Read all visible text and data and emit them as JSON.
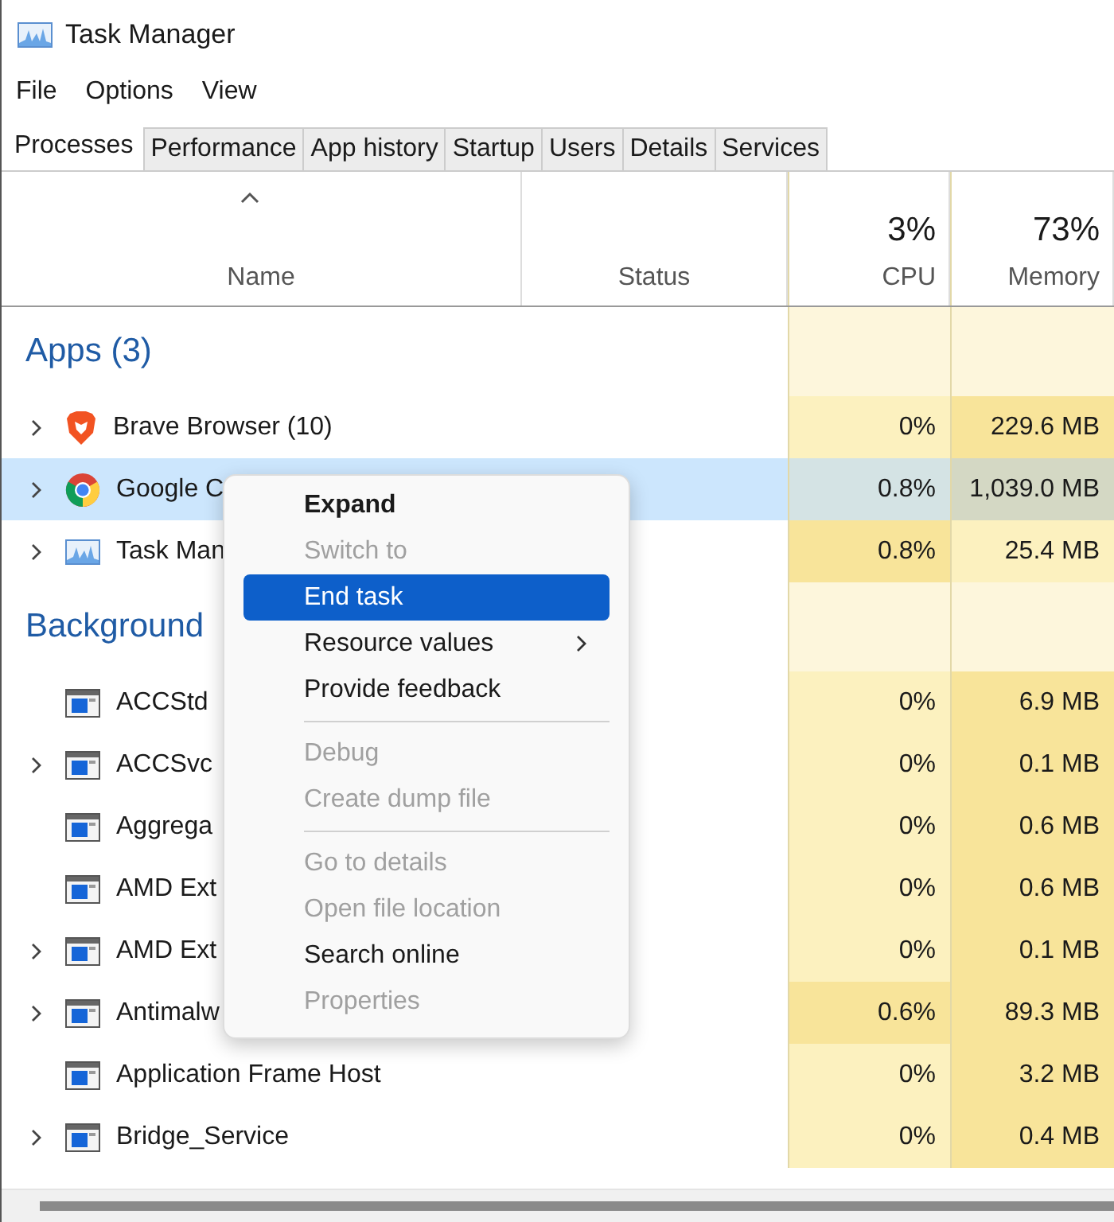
{
  "window": {
    "title": "Task Manager"
  },
  "menu": [
    "File",
    "Options",
    "View"
  ],
  "tabs": [
    {
      "label": "Processes",
      "selected": true
    },
    {
      "label": "Performance",
      "selected": false
    },
    {
      "label": "App history",
      "selected": false
    },
    {
      "label": "Startup",
      "selected": false
    },
    {
      "label": "Users",
      "selected": false
    },
    {
      "label": "Details",
      "selected": false
    },
    {
      "label": "Services",
      "selected": false
    }
  ],
  "table": {
    "columns": [
      {
        "label": "Name"
      },
      {
        "label": "Status"
      },
      {
        "label": "CPU",
        "summary": "3%"
      },
      {
        "label": "Memory",
        "summary": "73%"
      }
    ],
    "groups": [
      {
        "title": "Apps (3)",
        "rows": [
          {
            "name": "Brave Browser (10)",
            "expandable": true,
            "selected": false,
            "cpu": "0%",
            "cpu_hot": false,
            "memory": "229.6 MB",
            "memory_hot": true
          },
          {
            "name": "Google C",
            "expandable": true,
            "selected": true,
            "cpu": "0.8%",
            "cpu_hot": false,
            "memory": "1,039.0 MB",
            "memory_hot": true
          },
          {
            "name": "Task Man",
            "expandable": true,
            "selected": false,
            "cpu": "0.8%",
            "cpu_hot": true,
            "memory": "25.4 MB",
            "memory_hot": false
          }
        ]
      },
      {
        "title": "Background",
        "rows": [
          {
            "name": "ACCStd",
            "expandable": false,
            "selected": false,
            "cpu": "0%",
            "cpu_hot": false,
            "memory": "6.9 MB",
            "memory_hot": true
          },
          {
            "name": "ACCSvc",
            "expandable": true,
            "selected": false,
            "cpu": "0%",
            "cpu_hot": false,
            "memory": "0.1 MB",
            "memory_hot": true
          },
          {
            "name": "Aggrega",
            "expandable": false,
            "selected": false,
            "cpu": "0%",
            "cpu_hot": false,
            "memory": "0.6 MB",
            "memory_hot": true
          },
          {
            "name": "AMD Ext",
            "expandable": false,
            "selected": false,
            "cpu": "0%",
            "cpu_hot": false,
            "memory": "0.6 MB",
            "memory_hot": true
          },
          {
            "name": "AMD Ext",
            "expandable": true,
            "selected": false,
            "cpu": "0%",
            "cpu_hot": false,
            "memory": "0.1 MB",
            "memory_hot": true
          },
          {
            "name": "Antimalw",
            "expandable": true,
            "selected": false,
            "cpu": "0.6%",
            "cpu_hot": true,
            "memory": "89.3 MB",
            "memory_hot": true
          },
          {
            "name": "Application Frame Host",
            "expandable": false,
            "selected": false,
            "cpu": "0%",
            "cpu_hot": false,
            "memory": "3.2 MB",
            "memory_hot": true
          },
          {
            "name": "Bridge_Service",
            "expandable": true,
            "selected": false,
            "cpu": "0%",
            "cpu_hot": false,
            "memory": "0.4 MB",
            "memory_hot": true
          }
        ]
      }
    ]
  },
  "context_menu": [
    {
      "kind": "item",
      "label": "Expand",
      "bold": true,
      "disabled": false,
      "selected": false,
      "submenu": false
    },
    {
      "kind": "item",
      "label": "Switch to",
      "bold": false,
      "disabled": true,
      "selected": false,
      "submenu": false
    },
    {
      "kind": "item",
      "label": "End task",
      "bold": false,
      "disabled": false,
      "selected": true,
      "submenu": false
    },
    {
      "kind": "item",
      "label": "Resource values",
      "bold": false,
      "disabled": false,
      "selected": false,
      "submenu": true
    },
    {
      "kind": "item",
      "label": "Provide feedback",
      "bold": false,
      "disabled": false,
      "selected": false,
      "submenu": false
    },
    {
      "kind": "separator"
    },
    {
      "kind": "item",
      "label": "Debug",
      "bold": false,
      "disabled": true,
      "selected": false,
      "submenu": false
    },
    {
      "kind": "item",
      "label": "Create dump file",
      "bold": false,
      "disabled": true,
      "selected": false,
      "submenu": false
    },
    {
      "kind": "separator"
    },
    {
      "kind": "item",
      "label": "Go to details",
      "bold": false,
      "disabled": true,
      "selected": false,
      "submenu": false
    },
    {
      "kind": "item",
      "label": "Open file location",
      "bold": false,
      "disabled": true,
      "selected": false,
      "submenu": false
    },
    {
      "kind": "item",
      "label": "Search online",
      "bold": false,
      "disabled": false,
      "selected": false,
      "submenu": false
    },
    {
      "kind": "item",
      "label": "Properties",
      "bold": false,
      "disabled": true,
      "selected": false,
      "submenu": false
    }
  ]
}
